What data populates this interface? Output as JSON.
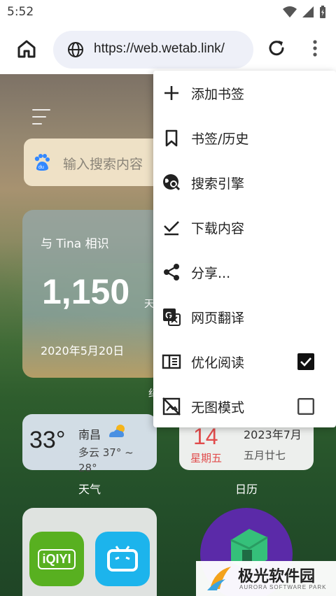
{
  "status_bar": {
    "time": "5:52",
    "icons": [
      "wifi-icon",
      "signal-icon",
      "battery-icon"
    ]
  },
  "toolbar": {
    "url": "https://web.wetab.link/",
    "icons": [
      "home-icon",
      "globe-icon",
      "reload-icon",
      "more-vert-icon"
    ]
  },
  "page": {
    "search_placeholder": "输入搜索内容",
    "countdown": {
      "title": "与 Tina 相识",
      "days": "1,150",
      "unit": "天",
      "date": "2020年5月20日"
    },
    "weather": {
      "temp": "33°",
      "city": "南昌",
      "desc": "多云 37° ~ 28°",
      "label": "天气"
    },
    "calendar": {
      "day": "14",
      "weekday": "星期五",
      "year_month": "2023年7月",
      "lunar": "五月廿七",
      "label": "日历"
    },
    "stray_label": "纪",
    "apps": [
      {
        "name": "iQIYI",
        "icon": "iqiyi-icon",
        "text": "iQIYI"
      },
      {
        "name": "bilibili",
        "icon": "bilibili-icon"
      }
    ]
  },
  "menu": {
    "items": [
      {
        "label": "添加书签",
        "icon": "plus-icon"
      },
      {
        "label": "书签/历史",
        "icon": "bookmark-icon"
      },
      {
        "label": "搜索引擎",
        "icon": "search-engine-icon"
      },
      {
        "label": "下载内容",
        "icon": "download-icon"
      },
      {
        "label": "分享...",
        "icon": "share-icon"
      },
      {
        "label": "网页翻译",
        "icon": "translate-icon"
      },
      {
        "label": "优化阅读",
        "icon": "reader-mode-icon",
        "checked": true
      },
      {
        "label": "无图模式",
        "icon": "no-image-icon",
        "checked": false
      }
    ]
  },
  "watermark": {
    "title": "极光软件园",
    "subtitle": "AURORA SOFTWARE PARK"
  },
  "colors": {
    "accent_red": "#e14c4c",
    "url_pill": "#eef0f8",
    "bili_blue": "#1cb4ec",
    "iqiyi_green": "#58b020"
  }
}
